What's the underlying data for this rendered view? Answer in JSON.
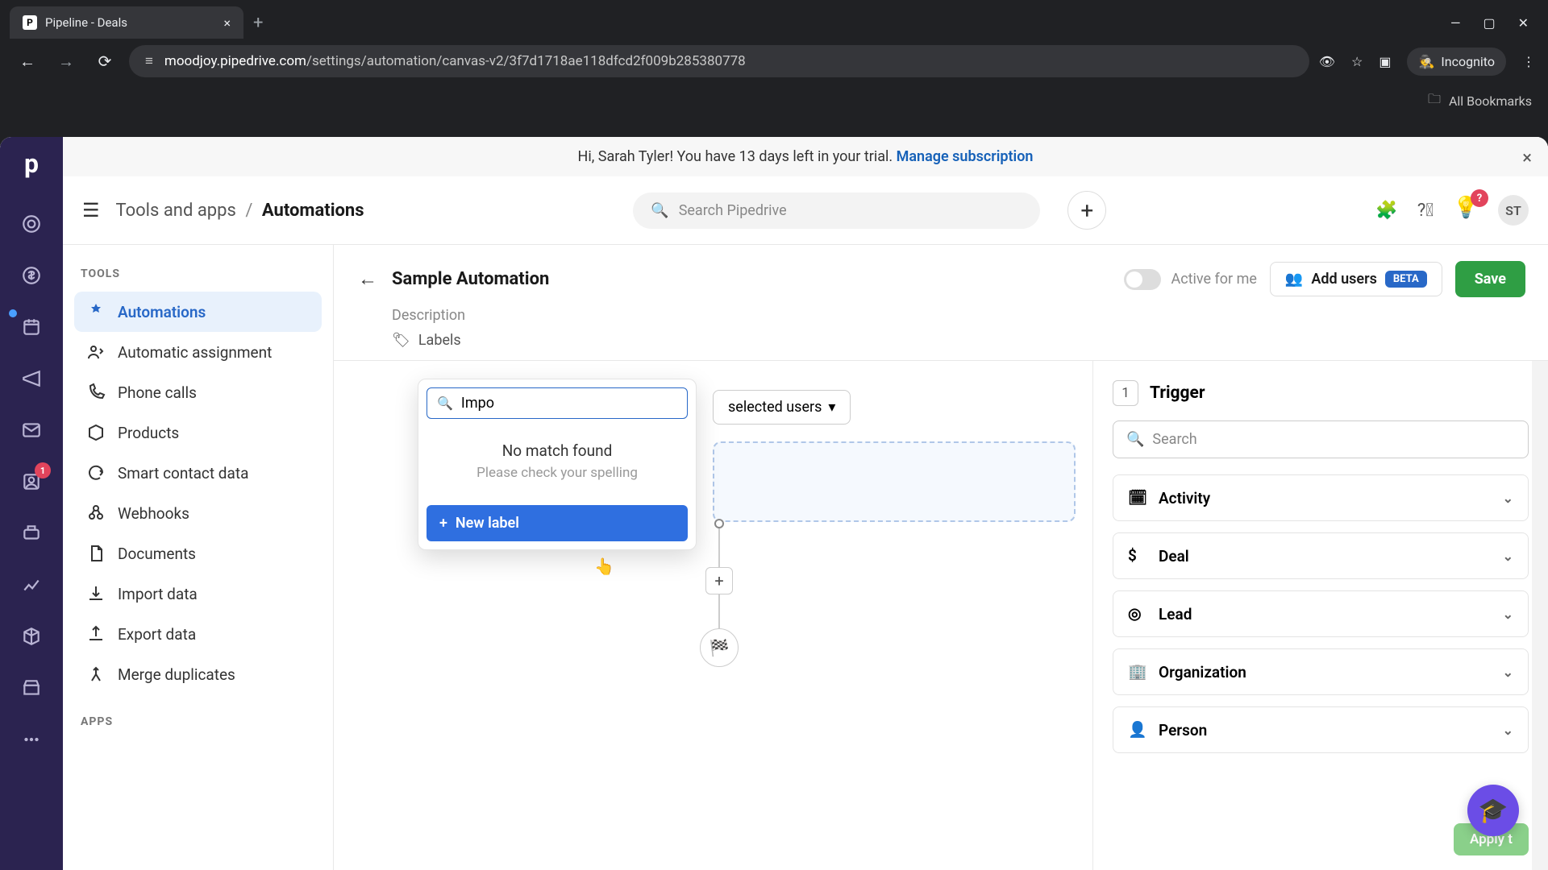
{
  "browser": {
    "tab_title": "Pipeline - Deals",
    "url_domain": "moodjoy.pipedrive.com",
    "url_path": "/settings/automation/canvas-v2/3f7d1718ae118dfcd2f009b285380778",
    "incognito": "Incognito",
    "bookmarks": "All Bookmarks"
  },
  "banner": {
    "text_prefix": "Hi, Sarah Tyler! You have 13 days left in your trial. ",
    "link": "Manage subscription"
  },
  "topbar": {
    "crumb1": "Tools and apps",
    "crumb2": "Automations",
    "search_placeholder": "Search Pipedrive",
    "avatar": "ST"
  },
  "rail": {
    "badge_contacts": "1"
  },
  "sidebar": {
    "tools_heading": "TOOLS",
    "apps_heading": "APPS",
    "items": [
      "Automations",
      "Automatic assignment",
      "Phone calls",
      "Products",
      "Smart contact data",
      "Webhooks",
      "Documents",
      "Import data",
      "Export data",
      "Merge duplicates"
    ]
  },
  "header": {
    "title": "Sample Automation",
    "description": "Description",
    "labels": "Labels",
    "active_for_me": "Active for me",
    "add_users": "Add users",
    "beta": "BETA",
    "save": "Save"
  },
  "canvas": {
    "dropdown_text": "selected users",
    "add_step": "+",
    "flag": "🏁"
  },
  "popover": {
    "search_value": "Impo",
    "no_match": "No match found",
    "check": "Please check your spelling",
    "new_label": "New label"
  },
  "trigger": {
    "step_num": "1",
    "title": "Trigger",
    "search_placeholder": "Search",
    "items": [
      "Activity",
      "Deal",
      "Lead",
      "Organization",
      "Person"
    ],
    "apply": "Apply t"
  }
}
